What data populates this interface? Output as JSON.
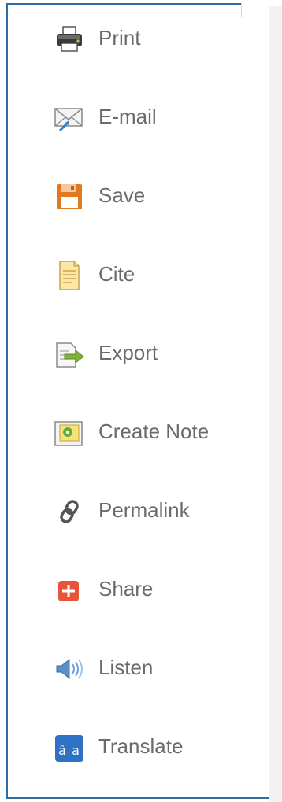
{
  "tools": {
    "items": [
      {
        "label": "Print",
        "icon": "printer-icon"
      },
      {
        "label": "E-mail",
        "icon": "email-envelope-icon"
      },
      {
        "label": "Save",
        "icon": "floppy-disk-icon"
      },
      {
        "label": "Cite",
        "icon": "citation-document-icon"
      },
      {
        "label": "Export",
        "icon": "export-arrow-icon"
      },
      {
        "label": "Create Note",
        "icon": "note-icon"
      },
      {
        "label": "Permalink",
        "icon": "chain-link-icon"
      },
      {
        "label": "Share",
        "icon": "plus-share-icon"
      },
      {
        "label": "Listen",
        "icon": "speaker-icon"
      },
      {
        "label": "Translate",
        "icon": "translate-icon"
      }
    ]
  },
  "colors": {
    "panel_border": "#2c6ea3",
    "label_text": "#6b6b6b",
    "share_red": "#e8543a",
    "translate_blue": "#2f72c4"
  }
}
